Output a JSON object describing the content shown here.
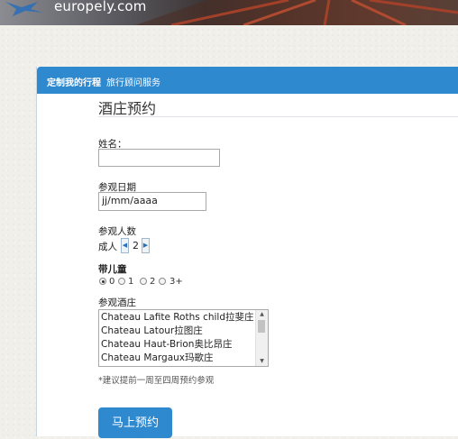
{
  "site": {
    "brand": "europely.com"
  },
  "colors": {
    "accent": "#2f89cf"
  },
  "panel": {
    "title": "定制我的行程",
    "subtitle": "旅行顾问服务"
  },
  "form": {
    "title": "酒庄预约",
    "name_label": "姓名：",
    "name_value": "",
    "date_label": "参观日期",
    "date_placeholder": "jj/mm/aaaa",
    "people_label": "参观人数",
    "adults_label": "成人",
    "adults_value": "2",
    "children_label": "带儿童",
    "children_options": [
      "0",
      "1",
      "2",
      "3+"
    ],
    "children_selected": "0",
    "chateau_label": "参观酒庄",
    "chateaux": [
      "Chateau Lafite Roths child拉斐庄",
      "Chateau Latour拉图庄",
      "Chateau Haut-Brion奥比昂庄",
      "Chateau Margaux玛歌庄"
    ],
    "note": "*建议提前一周至四周预约参观",
    "submit_label": "马上预约"
  }
}
